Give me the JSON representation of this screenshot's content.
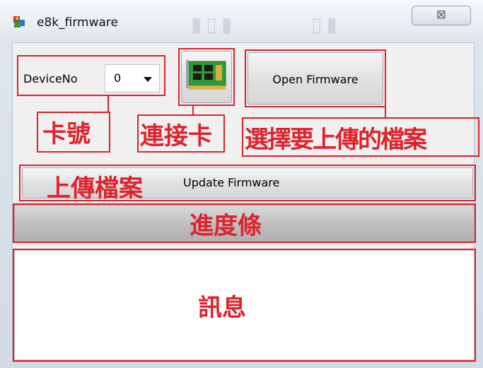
{
  "window": {
    "title": "e8k_firmware",
    "close_glyph": "⊠"
  },
  "controls": {
    "device_label": "DeviceNo",
    "device_value": "0",
    "open_button": "Open Firmware",
    "update_button": "Update Firmware",
    "progress_fraction": 0
  },
  "annotations": {
    "card_number": "卡號",
    "connect_card": "連接卡",
    "choose_file": "選擇要上傳的檔案",
    "upload_file": "上傳檔案",
    "progress_bar": "進度條",
    "message": "訊息"
  },
  "icons": {
    "app": "app-icon",
    "card": "pci-card-icon",
    "combo_arrow": "dropdown-arrow-icon"
  },
  "colors": {
    "annotation_red": "#e0212a",
    "card_green": "#2f9a3a"
  }
}
